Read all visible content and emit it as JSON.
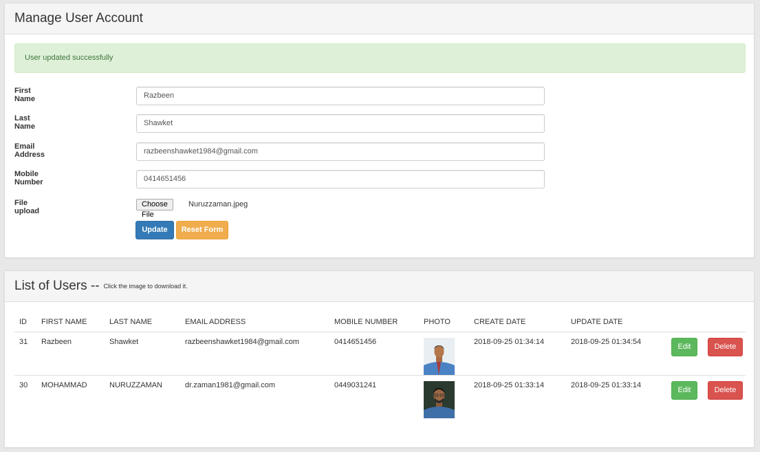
{
  "manage_panel": {
    "title": "Manage User Account",
    "alert": "User updated successfully",
    "fields": {
      "first_name": {
        "label": "First Name",
        "value": "Razbeen"
      },
      "last_name": {
        "label": "Last Name",
        "value": "Shawket"
      },
      "email": {
        "label": "Email Address",
        "value": "razbeenshawket1984@gmail.com"
      },
      "mobile": {
        "label": "Mobile Number",
        "value": "0414651456"
      }
    },
    "file_upload": {
      "label": "File upload",
      "button": "Choose File",
      "filename": "Nuruzzaman.jpeg"
    },
    "update_button": "Update",
    "reset_button": "Reset Form"
  },
  "users_panel": {
    "title": "List of Users --",
    "hint": "Click the image to download it.",
    "columns": [
      "ID",
      "FIRST NAME",
      "LAST NAME",
      "EMAIL ADDRESS",
      "MOBILE NUMBER",
      "PHOTO",
      "CREATE DATE",
      "UPDATE DATE"
    ],
    "rows": [
      {
        "id": "31",
        "first": "Razbeen",
        "last": "Shawket",
        "email": "razbeenshawket1984@gmail.com",
        "mobile": "0414651456",
        "created": "2018-09-25 01:34:14",
        "updated": "2018-09-25 01:34:54"
      },
      {
        "id": "30",
        "first": "MOHAMMAD",
        "last": "NURUZZAMAN",
        "email": "dr.zaman1981@gmail.com",
        "mobile": "0449031241",
        "created": "2018-09-25 01:33:14",
        "updated": "2018-09-25 01:33:14"
      }
    ],
    "edit_label": "Edit",
    "delete_label": "Delete"
  }
}
